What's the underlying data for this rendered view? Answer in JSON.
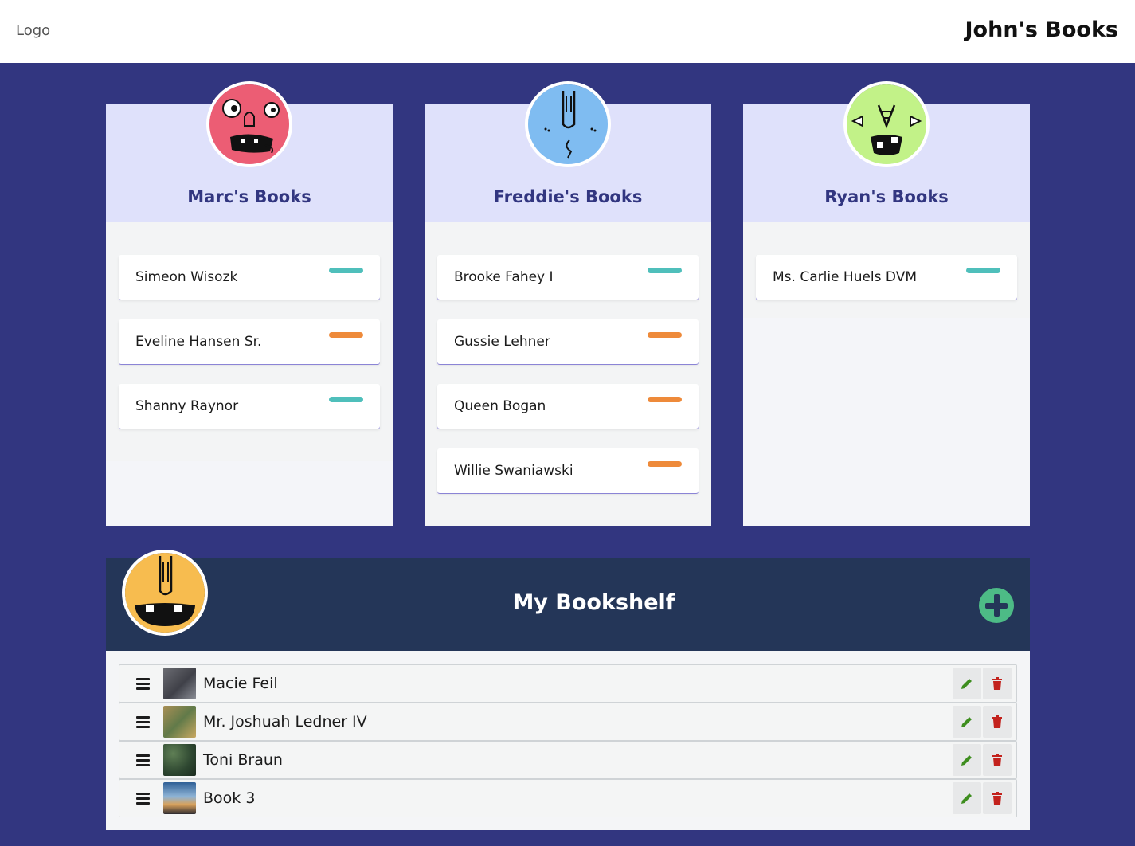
{
  "header": {
    "logo": "Logo",
    "title": "John's Books"
  },
  "friends": [
    {
      "title": "Marc's Books",
      "avatar_color": "#ec5d74",
      "books": [
        {
          "name": "Simeon Wisozk",
          "tag_color": "#4fbfbb"
        },
        {
          "name": "Eveline Hansen Sr.",
          "tag_color": "#ee8a3a"
        },
        {
          "name": "Shanny Raynor",
          "tag_color": "#4fbfbb"
        }
      ]
    },
    {
      "title": "Freddie's Books",
      "avatar_color": "#7fbcf1",
      "books": [
        {
          "name": "Brooke Fahey I",
          "tag_color": "#4fbfbb"
        },
        {
          "name": "Gussie Lehner",
          "tag_color": "#ee8a3a"
        },
        {
          "name": "Queen Bogan",
          "tag_color": "#ee8a3a"
        },
        {
          "name": "Willie Swaniawski",
          "tag_color": "#ee8a3a"
        }
      ]
    },
    {
      "title": "Ryan's Books",
      "avatar_color": "#c2f288",
      "books": [
        {
          "name": "Ms. Carlie Huels DVM",
          "tag_color": "#4fbfbb"
        }
      ]
    }
  ],
  "bookshelf": {
    "title": "My Bookshelf",
    "avatar_color": "#f7bc4f",
    "items": [
      {
        "name": "Macie Feil"
      },
      {
        "name": "Mr. Joshuah Ledner IV"
      },
      {
        "name": "Toni Braun"
      },
      {
        "name": "Book 3"
      }
    ]
  },
  "colors": {
    "accent": "#323680",
    "add": "#4dbb86",
    "edit": "#3e8e1f",
    "delete": "#c3221d"
  }
}
